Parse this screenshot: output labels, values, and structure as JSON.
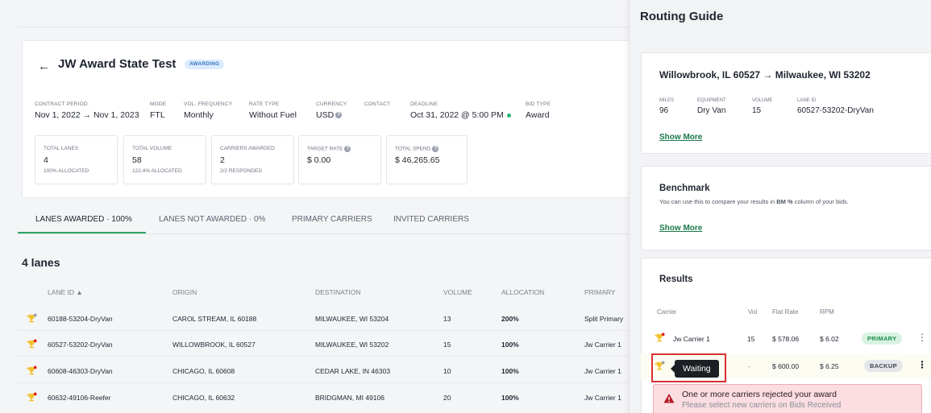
{
  "header": {
    "title": "JW Award State Test",
    "status": "AWARDING"
  },
  "meta": [
    {
      "label": "CONTRACT PERIOD",
      "value": "Nov 1, 2022 → Nov 1, 2023"
    },
    {
      "label": "MODE",
      "value": "FTL"
    },
    {
      "label": "VOL. FREQUENCY",
      "value": "Monthly"
    },
    {
      "label": "RATE TYPE",
      "value": "Without Fuel"
    },
    {
      "label": "CURRENCY",
      "value": "USD"
    },
    {
      "label": "CONTACT",
      "value": ""
    },
    {
      "label": "DEADLINE",
      "value": "Oct 31, 2022 @ 5:00 PM"
    },
    {
      "label": "BID TYPE",
      "value": "Award"
    }
  ],
  "stats": [
    {
      "label": "TOTAL LANES",
      "value": "4",
      "sub": "100% ALLOCATED"
    },
    {
      "label": "TOTAL VOLUME",
      "value": "58",
      "sub": "122.4% ALLOCATED"
    },
    {
      "label": "CARRIERS AWARDED",
      "value": "2",
      "sub": "2/2 RESPONDED"
    },
    {
      "label": "TARGET RATE",
      "value": "$ 0.00",
      "sub": ""
    },
    {
      "label": "TOTAL SPEND",
      "value": "$ 46,265.65",
      "sub": ""
    }
  ],
  "tabs": [
    {
      "label": "LANES AWARDED  ·  100%"
    },
    {
      "label": "LANES NOT AWARDED  ·  0%"
    },
    {
      "label": "PRIMARY CARRIERS"
    },
    {
      "label": "INVITED CARRIERS"
    }
  ],
  "lanes": {
    "heading": "4 lanes",
    "columns": [
      "LANE ID ▲",
      "ORIGIN",
      "DESTINATION",
      "VOLUME",
      "ALLOCATION",
      "PRIMARY"
    ],
    "rows": [
      {
        "lane_id": "60188-53204-DryVan",
        "origin": "CAROL STREAM, IL 60188",
        "destination": "MILWAUKEE, WI 53204",
        "volume": "13",
        "allocation": "200%",
        "primary": "Split Primary"
      },
      {
        "lane_id": "60527-53202-DryVan",
        "origin": "WILLOWBROOK, IL 60527",
        "destination": "MILWAUKEE, WI 53202",
        "volume": "15",
        "allocation": "100%",
        "primary": "Jw Carrier 1"
      },
      {
        "lane_id": "60608-46303-DryVan",
        "origin": "CHICAGO, IL 60608",
        "destination": "CEDAR LAKE, IN 46303",
        "volume": "10",
        "allocation": "100%",
        "primary": "Jw Carrier 1"
      },
      {
        "lane_id": "60632-49106-Reefer",
        "origin": "CHICAGO, IL 60632",
        "destination": "BRIDGMAN, MI 49106",
        "volume": "20",
        "allocation": "100%",
        "primary": "Jw Carrier 1"
      }
    ]
  },
  "routing": {
    "title": "Routing Guide",
    "route": "Willowbrook, IL 60527 → Milwaukee, WI 53202",
    "fields": [
      {
        "label": "MILES",
        "value": "96"
      },
      {
        "label": "EQUIPMENT",
        "value": "Dry Van"
      },
      {
        "label": "VOLUME",
        "value": "15"
      },
      {
        "label": "LANE ID",
        "value": "60527-53202-DryVan"
      }
    ],
    "show_more": "Show More",
    "benchmark": {
      "title": "Benchmark",
      "desc_prefix": "You can use this to compare your results in ",
      "desc_bold": "BM %",
      "desc_suffix": " column of your bids.",
      "show_more": "Show More"
    },
    "results": {
      "title": "Results",
      "columns": [
        "Carrier",
        "Vol",
        "Flat Rate",
        "RPM"
      ],
      "rows": [
        {
          "carrier": "Jw Carrier 1",
          "vol": "15",
          "flat_rate": "$ 578.06",
          "rpm": "$ 6.02",
          "badge": "PRIMARY"
        },
        {
          "carrier": "",
          "vol": "-",
          "flat_rate": "$ 600.00",
          "rpm": "$ 6.25",
          "badge": "BACKUP"
        }
      ],
      "tooltip": "Waiting"
    },
    "alert": {
      "title": "One or more carriers rejected your award",
      "sub": "Please select new carriers on Bids Received"
    }
  },
  "colors": {
    "accent_green": "#2aa565",
    "alert_red": "#d93030",
    "trophy_gold": "#f2c230",
    "dot_red": "#e0201e"
  },
  "icons": [
    "back-arrow-icon",
    "help-icon",
    "trophy-icon",
    "warning-icon",
    "kebab-menu-icon"
  ]
}
